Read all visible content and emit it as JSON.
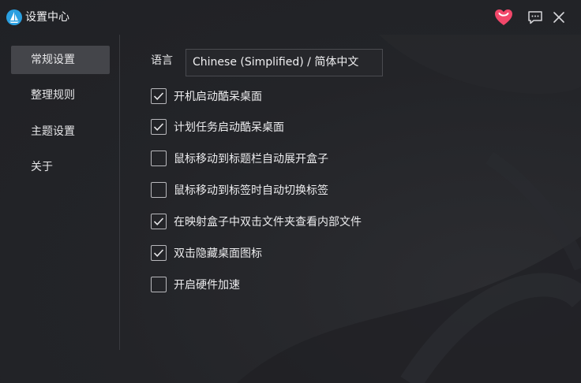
{
  "window": {
    "title": "设置中心"
  },
  "titlebar": {
    "icons": [
      "app-logo-icon",
      "heart-icon",
      "feedback-icon",
      "close-icon"
    ],
    "heart_color": "#f2476a"
  },
  "sidebar": {
    "items": [
      {
        "label": "常规设置",
        "active": true
      },
      {
        "label": "整理规则",
        "active": false
      },
      {
        "label": "主题设置",
        "active": false
      },
      {
        "label": "关于",
        "active": false
      }
    ]
  },
  "general": {
    "language_label": "语言",
    "language_value": "Chinese (Simplified) / 简体中文",
    "options": [
      {
        "label": "开机启动酷呆桌面",
        "checked": true
      },
      {
        "label": "计划任务启动酷呆桌面",
        "checked": true
      },
      {
        "label": "鼠标移动到标题栏自动展开盒子",
        "checked": false
      },
      {
        "label": "鼠标移动到标签时自动切换标签",
        "checked": false
      },
      {
        "label": "在映射盒子中双击文件夹查看内部文件",
        "checked": true
      },
      {
        "label": "双击隐藏桌面图标",
        "checked": true
      },
      {
        "label": "开启硬件加速",
        "checked": false
      }
    ]
  }
}
